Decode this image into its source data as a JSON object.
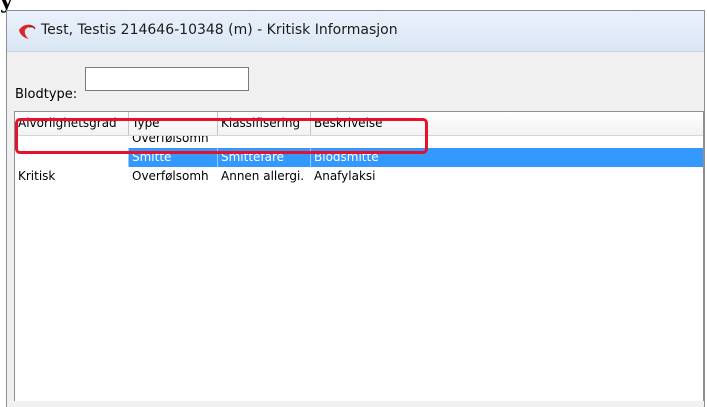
{
  "window": {
    "title": "Test, Testis  214646-10348 (m) - Kritisk Informasjon",
    "cut_text": "y"
  },
  "blood_type": {
    "label": "Blodtype:",
    "value": ""
  },
  "table": {
    "columns": [
      "Alvorlighetsgrad",
      "Type",
      "Klassifisering",
      "Beskrivelse"
    ],
    "rows": [
      {
        "alvorlighetsgrad": "",
        "type": "Overfølsomh",
        "klassifisering": "",
        "beskrivelse": ""
      },
      {
        "alvorlighetsgrad": "",
        "type": "Smitte",
        "klassifisering": "Smittefare",
        "beskrivelse": "Blodsmitte",
        "selected": true
      },
      {
        "alvorlighetsgrad": "Kritisk",
        "type": "Overfølsomh",
        "klassifisering": "Annen allergi.",
        "beskrivelse": "Anafylaksi"
      }
    ]
  },
  "colors": {
    "selection": "#3399ff",
    "highlight_border": "#e8102a"
  },
  "icons": {
    "app": "red-swoosh-icon"
  }
}
